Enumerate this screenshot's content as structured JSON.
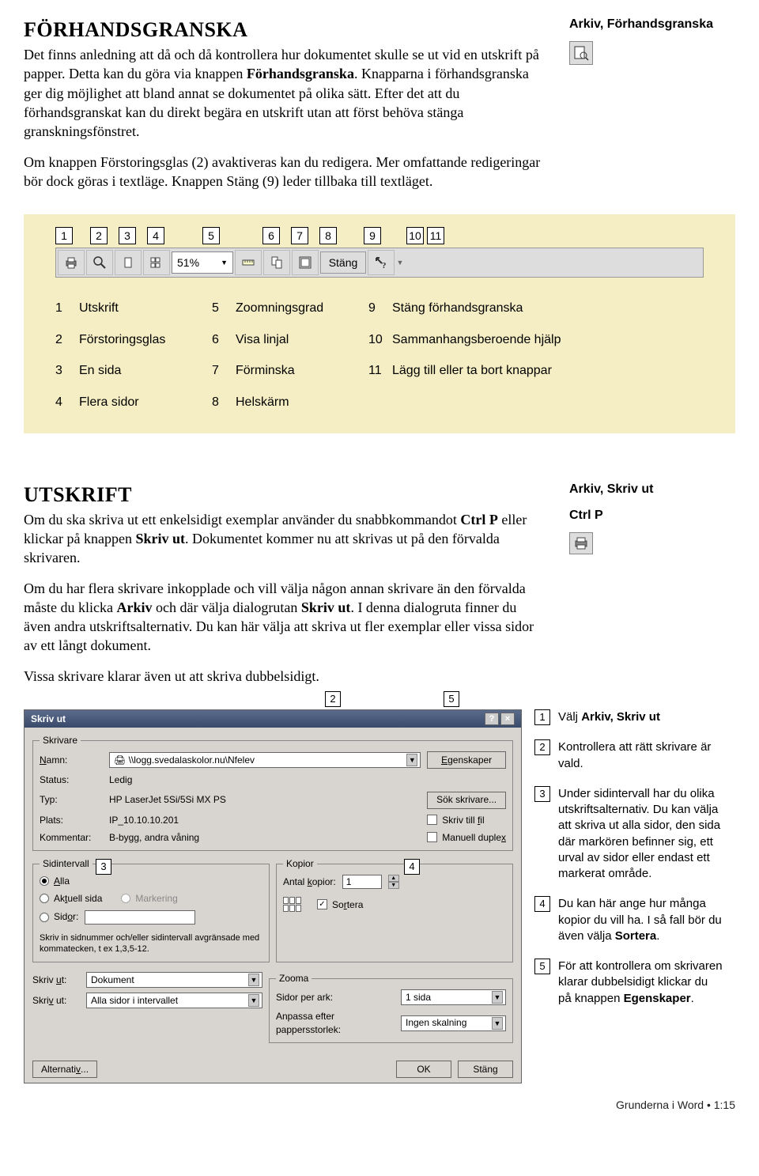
{
  "section1": {
    "title": "FÖRHANDSGRANSKA",
    "para1_a": "Det finns anledning att då och då kontrollera hur dokumentet skulle se ut vid en utskrift på papper. Detta kan du göra via knappen ",
    "para1_bold1": "Förhandsgranska",
    "para1_b": ". Knapparna i förhandsgranska ger dig möjlighet att bland annat se dokumentet på olika sätt. Efter det att du förhandsgranskat kan du direkt begära en utskrift utan att först behöva stänga granskningsfönstret.",
    "para2_a": "Om knappen Förstoringsglas (2) avaktiveras kan du redigera. Mer omfattande redigeringar bör dock göras i textläge. Knappen Stäng (9) leder tillbaka till textläget.",
    "side_title": "Arkiv, Förhandsgranska"
  },
  "numbers": [
    "1",
    "2",
    "3",
    "4",
    "5",
    "6",
    "7",
    "8",
    "9",
    "10",
    "11"
  ],
  "toolbar": {
    "zoom": "51%",
    "close": "Stäng"
  },
  "legend": [
    {
      "n": "1",
      "t": "Utskrift"
    },
    {
      "n": "5",
      "t": "Zoomningsgrad"
    },
    {
      "n": "9",
      "t": "Stäng förhandsgranska"
    },
    {
      "n": "2",
      "t": "Förstoringsglas"
    },
    {
      "n": "6",
      "t": "Visa linjal"
    },
    {
      "n": "10",
      "t": "Sammanhangsberoende hjälp"
    },
    {
      "n": "3",
      "t": "En sida"
    },
    {
      "n": "7",
      "t": "Förminska"
    },
    {
      "n": "11",
      "t": "Lägg till eller ta bort knappar"
    },
    {
      "n": "4",
      "t": "Flera sidor"
    },
    {
      "n": "8",
      "t": "Helskärm"
    }
  ],
  "section2": {
    "title": "UTSKRIFT",
    "para1_a": "Om du ska skriva ut ett enkelsidigt exemplar använder du snabbkommandot ",
    "para1_bold1": "Ctrl P",
    "para1_b": " eller klickar på knappen ",
    "para1_bold2": "Skriv ut",
    "para1_c": ". Dokumentet kommer nu att skrivas ut på den förvalda skrivaren.",
    "para2_a": "Om du har flera skrivare inkopplade och vill välja någon annan skrivare än den förvalda måste du klicka ",
    "para2_bold1": "Arkiv",
    "para2_b": " och där välja dialogrutan ",
    "para2_bold2": "Skriv ut",
    "para2_c": ". I denna dialogruta finner du även andra utskriftsalternativ. Du kan här välja att skriva ut fler exemplar eller vissa sidor av ett långt dokument.",
    "para3": "Vissa skrivare klarar även ut att skriva dubbelsidigt.",
    "side_title": "Arkiv, Skriv ut",
    "side_shortcut": "Ctrl P"
  },
  "dlg": {
    "title": "Skriv ut",
    "printer_legend": "Skrivare",
    "name_label": "Namn:",
    "name_value": "\\\\logg.svedalaskolor.nu\\Nfelev",
    "properties": "Egenskaper",
    "status_label": "Status:",
    "status_value": "Ledig",
    "find_printer": "Sök skrivare...",
    "type_label": "Typ:",
    "type_value": "HP LaserJet 5Si/5Si MX PS",
    "where_label": "Plats:",
    "where_value": "IP_10.10.10.201",
    "print_to_file": "Skriv till fil",
    "comment_label": "Kommentar:",
    "comment_value": "B-bygg, andra våning",
    "manual_duplex": "Manuell duplex",
    "range_legend": "Sidintervall",
    "all": "Alla",
    "current": "Aktuell sida",
    "selection": "Markering",
    "pages": "Sidor:",
    "range_hint": "Skriv in sidnummer och/eller sidintervall avgränsade med kommatecken, t ex 1,3,5-12.",
    "copies_legend": "Kopior",
    "copies_label": "Antal kopior:",
    "copies_value": "1",
    "collate": "Sortera",
    "print_what_label": "Skriv ut:",
    "print_what_value": "Dokument",
    "print_label": "Skriv ut:",
    "print_value": "Alla sidor i intervallet",
    "zoom_legend": "Zooma",
    "pages_per_sheet_label": "Sidor per ark:",
    "pages_per_sheet_value": "1 sida",
    "scale_label": "Anpassa efter pappersstorlek:",
    "scale_value": "Ingen skalning",
    "options": "Alternativ...",
    "ok": "OK",
    "cancel": "Stäng"
  },
  "steps": [
    {
      "n": "1",
      "head": "Välj ",
      "bold": "Arkiv, Skriv ut",
      "tail": ""
    },
    {
      "n": "2",
      "head": "Kontrollera att rätt skrivare är vald.",
      "bold": "",
      "tail": ""
    },
    {
      "n": "3",
      "head": "Under sidintervall har du olika utskriftsalternativ. Du kan välja att skriva ut alla sidor, den sida där markören befinner sig, ett urval av sidor eller endast ett markerat område.",
      "bold": "",
      "tail": ""
    },
    {
      "n": "4",
      "head": "Du kan här ange hur många kopior du vill ha. I så fall bör du även välja ",
      "bold": "Sortera",
      "tail": "."
    },
    {
      "n": "5",
      "head": "För att kontrollera om skrivaren klarar dubbelsidigt klickar du på knappen ",
      "bold": "Egenskaper",
      "tail": "."
    }
  ],
  "footer": "Grunderna i Word • 1:15"
}
